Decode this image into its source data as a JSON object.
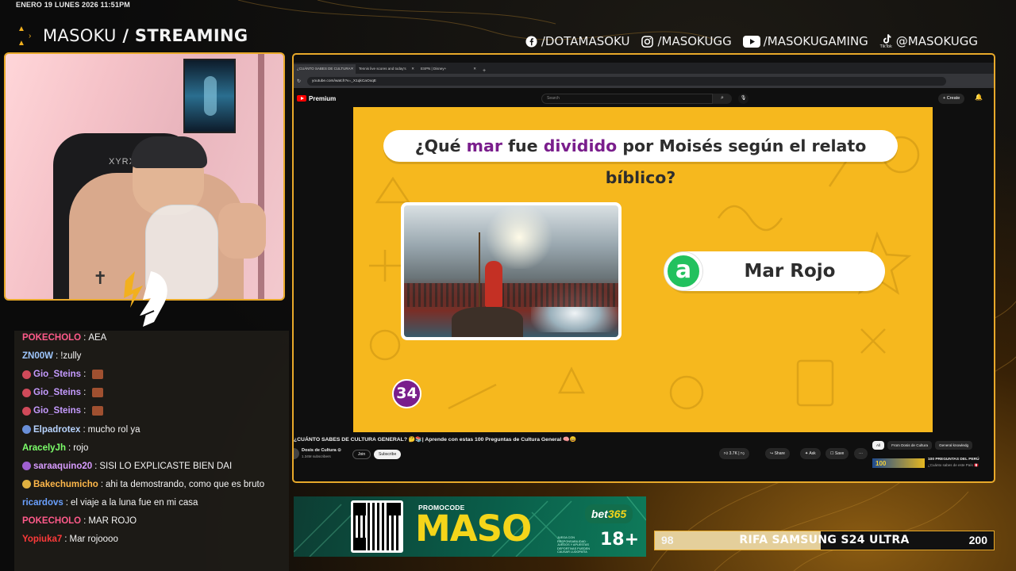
{
  "overlay": {
    "date": "ENERO 19 LUNES 2026 11:51PM",
    "brand_name": "MASOKU",
    "brand_suffix": " / STREAMING",
    "accent": "#e8a92a",
    "socials": [
      {
        "icon": "facebook-icon",
        "label": "/DOTAMASOKU"
      },
      {
        "icon": "instagram-icon",
        "label": "/MASOKUGG"
      },
      {
        "icon": "youtube-icon",
        "label": "/MASOKUGAMING"
      },
      {
        "icon": "tiktok-icon",
        "label": "@MASOKUGG",
        "sub": "TikTok"
      }
    ],
    "cam_chair_text": "XYRX"
  },
  "chat": [
    {
      "user": "POKECHOLO",
      "color": "#ff5a8a",
      "msg": "AEA",
      "badge": null
    },
    {
      "user": "ZN00W",
      "color": "#9fc7ff",
      "msg": "!zully",
      "badge": null
    },
    {
      "user": "Gio_Steins",
      "color": "#c59bff",
      "msg": "",
      "badge": "#d04a5a",
      "emote": true
    },
    {
      "user": "Gio_Steins",
      "color": "#c59bff",
      "msg": "",
      "badge": "#d04a5a",
      "emote": true
    },
    {
      "user": "Gio_Steins",
      "color": "#c59bff",
      "msg": "",
      "badge": "#d04a5a",
      "emote": true
    },
    {
      "user": "Elpadrotex",
      "color": "#b8d4ff",
      "msg": "mucho rol ya",
      "badge": "#6a8fd8"
    },
    {
      "user": "AracelyJh",
      "color": "#7cff6a",
      "msg": "rojo",
      "badge": null
    },
    {
      "user": "saraaquino20",
      "color": "#d89cff",
      "msg": "SISI LO EXPLICASTE BIEN DAI",
      "badge": "#a060d0"
    },
    {
      "user": "Bakechumicho",
      "color": "#ffb84a",
      "msg": "ahi ta demostrando, como que es bruto",
      "badge": "#e0b040"
    },
    {
      "user": "ricardovs",
      "color": "#6aa0ff",
      "msg": "el viaje a la luna fue en mi casa",
      "badge": null
    },
    {
      "user": "POKECHOLO",
      "color": "#ff5a8a",
      "msg": "MAR ROJO",
      "badge": null
    },
    {
      "user": "Yopiuka7",
      "color": "#ff3a3a",
      "msg": "Mar rojoooo",
      "badge": null
    }
  ],
  "browser": {
    "tabs": [
      {
        "title": "¿CUÁNTO SABES DE CULTURA",
        "active": true
      },
      {
        "title": "Tennis live scores and today's",
        "active": false
      },
      {
        "title": "ESPN | Disney+",
        "active": false
      }
    ],
    "url": "youtube.com/watch?v=_X1qkCaOxqE",
    "yt_brand": "Premium",
    "search_placeholder": "Search",
    "create_label": "+ Create"
  },
  "video": {
    "question_pre": "¿Qué ",
    "question_hl1": "mar",
    "question_mid": " fue ",
    "question_hl2": "dividido",
    "question_post": " por Moisés según el relato bíblico?",
    "answer_letter": "a",
    "answer_text": "Mar Rojo",
    "counter": "34",
    "title": "¿CUÁNTO SABES DE CULTURA GENERAL? 🤔📚| Aprende con estas 100 Preguntas de Cultura General 🧠😄",
    "channel_name": "Dosis de Cultura ⊙",
    "channel_subs": "1.34M subscribers",
    "join_label": "Join",
    "subscribe_label": "Subscribe",
    "likes": "3.7K",
    "share_label": "Share",
    "ask_label": "Ask",
    "save_label": "Save",
    "more_label": "···",
    "chips": [
      "All",
      "From Dosis de Cultura",
      "General knowledg"
    ],
    "rec_title": "100 PREGUNTAS DEL PERÚ",
    "rec_subtitle": "¿Cuánto sabes de este País 🇵🇪",
    "rec_thumb_text": "100"
  },
  "sponsor": {
    "promo_label": "PROMOCODE",
    "code": "MASO",
    "brand_a": "bet",
    "brand_b": "365",
    "age": "18+",
    "fine_print": "JUEGA CON RESPONSABILIDAD · JUEGOS Y APUESTAS DEPORTIVAS PUEDEN CAUSAR LUDOPATÍA"
  },
  "raffle": {
    "left_value": "98",
    "title": "RIFA SAMSUNG S24 ULTRA",
    "right_value": "200",
    "progress": 0.49
  }
}
